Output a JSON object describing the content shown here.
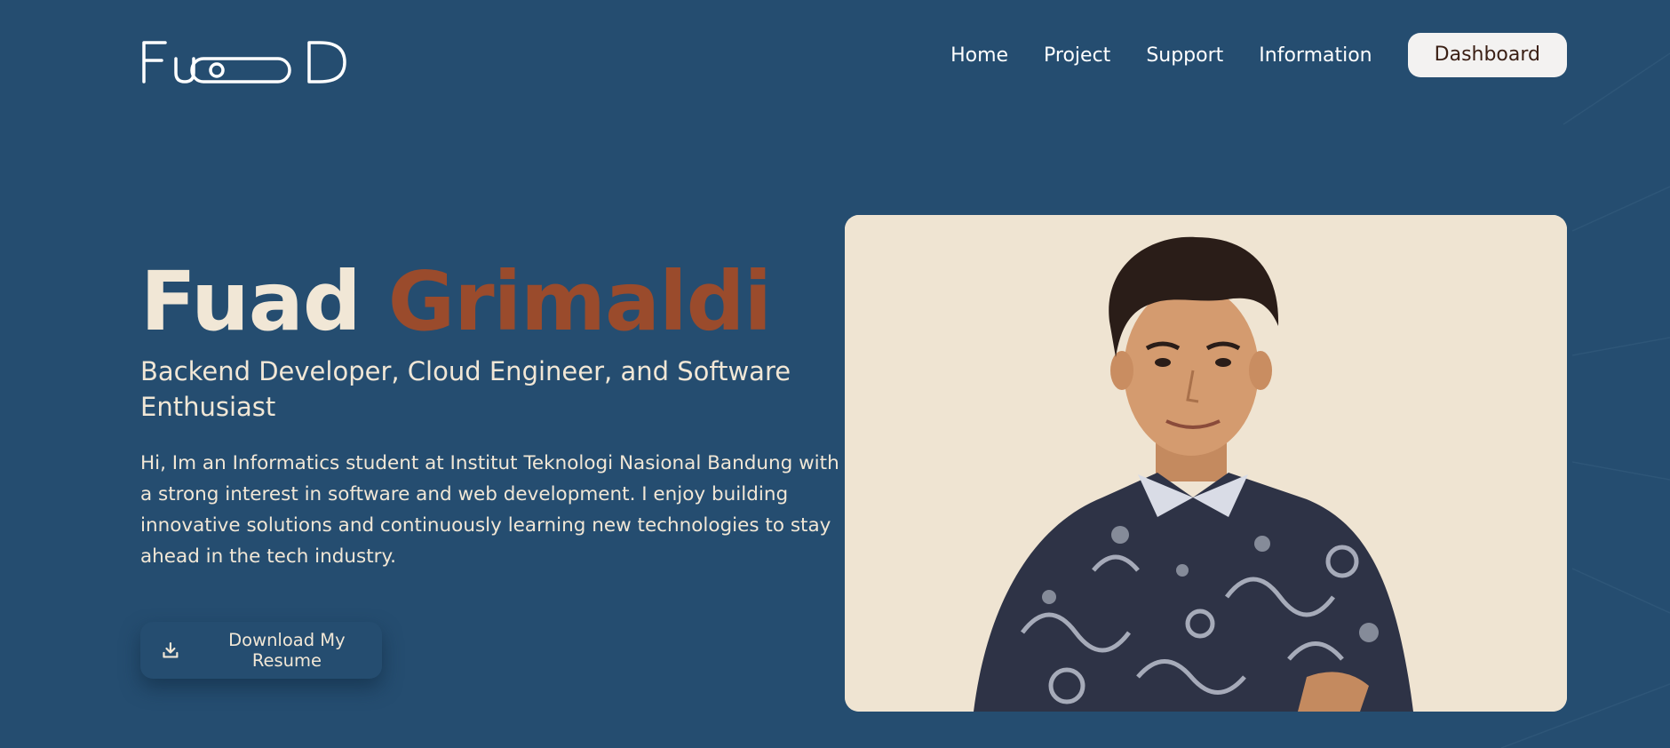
{
  "brand": {
    "logo_text": "FuOOD"
  },
  "nav": {
    "links": [
      "Home",
      "Project",
      "Support",
      "Information"
    ],
    "dashboard_label": "Dashboard"
  },
  "hero": {
    "first_name": "Fuad",
    "last_name": "Grimaldi",
    "role": "Backend Developer, Cloud Engineer, and Software Enthusiast",
    "bio": "Hi, Im an Informatics student at Institut Teknologi Nasional Bandung with a strong interest in software and web development. I enjoy building innovative solutions and continuously learning new technologies to stay ahead in the tech industry.",
    "resume_label": "Download My Resume"
  },
  "colors": {
    "background": "#254d70",
    "accent": "#9a4b2c",
    "text": "#f1e7d6",
    "photo_bg": "#efe4d2"
  },
  "icons": {
    "resume": "download-icon"
  }
}
